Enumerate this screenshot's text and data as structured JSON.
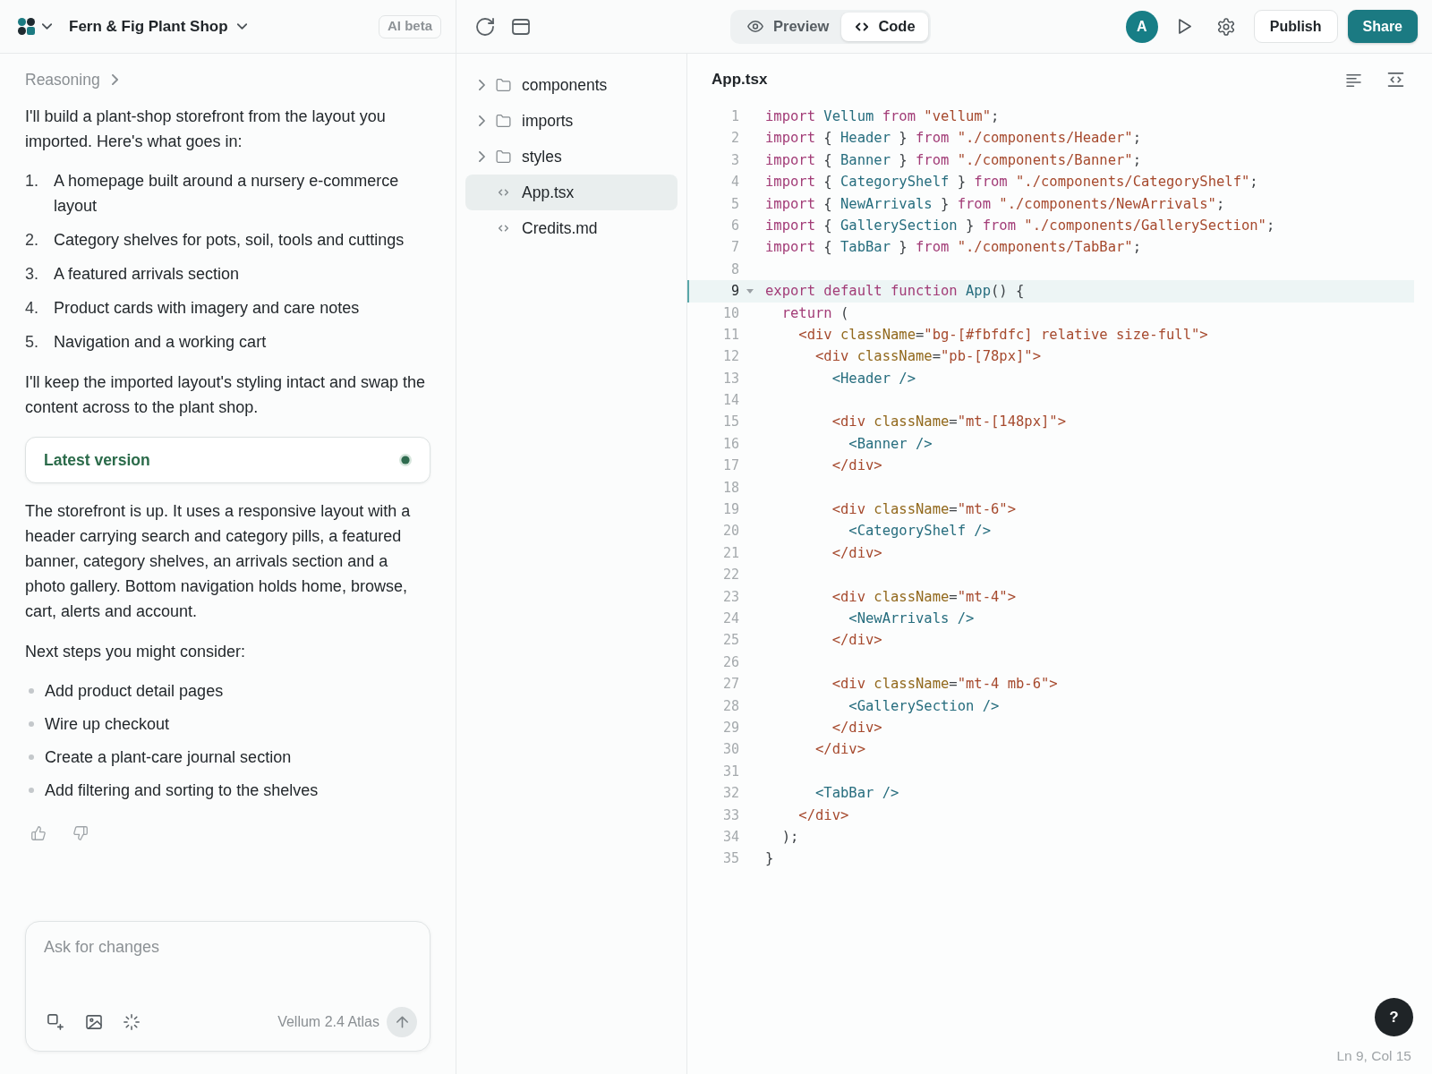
{
  "top_bar": {
    "project_title": "Fern & Fig Plant Shop",
    "badge": "AI beta",
    "view_tabs": [
      {
        "label": "Preview",
        "selected": false
      },
      {
        "label": "Code",
        "selected": true
      }
    ],
    "avatar": "A",
    "buttons": [
      {
        "label": "Publish",
        "kind": "secondary"
      },
      {
        "label": "Share",
        "kind": "primary"
      }
    ]
  },
  "chat": {
    "reasoning_label": "Reasoning",
    "blocks": [
      {
        "kind": "paragraph",
        "text": "I'll build a plant-shop storefront from the layout you imported. Here's what goes in:"
      },
      {
        "kind": "numbered_list",
        "items": [
          {
            "marker": "1.",
            "text": "A homepage built around a nursery e-commerce layout"
          },
          {
            "marker": "2.",
            "text": "Category shelves for pots, soil, tools and cuttings"
          },
          {
            "marker": "3.",
            "text": "A featured arrivals section"
          },
          {
            "marker": "4.",
            "text": "Product cards with imagery and care notes"
          },
          {
            "marker": "5.",
            "text": "Navigation and a working cart"
          }
        ]
      },
      {
        "kind": "paragraph",
        "text": "I'll keep the imported layout's styling intact and swap the content across to the plant shop."
      },
      {
        "kind": "version_card",
        "label": "Latest version"
      },
      {
        "kind": "paragraph",
        "text": "The storefront is up. It uses a responsive layout with a header carrying search and category pills, a featured banner, category shelves, an arrivals section and a photo gallery. Bottom navigation holds home, browse, cart, alerts and account."
      },
      {
        "kind": "paragraph",
        "text": "Next steps you might consider:"
      },
      {
        "kind": "bullet_list",
        "items": [
          "Add product detail pages",
          "Wire up checkout",
          "Create a plant-care journal section",
          "Add filtering and sorting to the shelves"
        ]
      }
    ]
  },
  "composer": {
    "placeholder": "Ask for changes",
    "model": "Vellum 2.4 Atlas"
  },
  "file_tree": {
    "items": [
      {
        "name": "components",
        "kind": "folder",
        "expanded": false,
        "selected": false
      },
      {
        "name": "imports",
        "kind": "folder",
        "expanded": false,
        "selected": false
      },
      {
        "name": "styles",
        "kind": "folder",
        "expanded": false,
        "selected": false
      },
      {
        "name": "App.tsx",
        "kind": "file",
        "selected": true
      },
      {
        "name": "Credits.md",
        "kind": "file",
        "selected": false
      }
    ]
  },
  "editor": {
    "file_name": "App.tsx",
    "lines": [
      {
        "number": "1",
        "selected": false,
        "tokens": [
          {
            "kind": "keyword",
            "text": "import "
          },
          {
            "kind": "identifier",
            "text": "Vellum "
          },
          {
            "kind": "keyword",
            "text": "from "
          },
          {
            "kind": "string",
            "text": "\"vellum\""
          },
          {
            "kind": "punctuation",
            "text": ";"
          }
        ]
      },
      {
        "number": "2",
        "selected": false,
        "tokens": [
          {
            "kind": "keyword",
            "text": "import "
          },
          {
            "kind": "punctuation",
            "text": "{ "
          },
          {
            "kind": "identifier",
            "text": "Header"
          },
          {
            "kind": "punctuation",
            "text": " } "
          },
          {
            "kind": "keyword",
            "text": "from "
          },
          {
            "kind": "string",
            "text": "\"./components/Header\""
          },
          {
            "kind": "punctuation",
            "text": ";"
          }
        ]
      },
      {
        "number": "3",
        "selected": false,
        "tokens": [
          {
            "kind": "keyword",
            "text": "import "
          },
          {
            "kind": "punctuation",
            "text": "{ "
          },
          {
            "kind": "identifier",
            "text": "Banner"
          },
          {
            "kind": "punctuation",
            "text": " } "
          },
          {
            "kind": "keyword",
            "text": "from "
          },
          {
            "kind": "string",
            "text": "\"./components/Banner\""
          },
          {
            "kind": "punctuation",
            "text": ";"
          }
        ]
      },
      {
        "number": "4",
        "selected": false,
        "tokens": [
          {
            "kind": "keyword",
            "text": "import "
          },
          {
            "kind": "punctuation",
            "text": "{ "
          },
          {
            "kind": "identifier",
            "text": "CategoryShelf"
          },
          {
            "kind": "punctuation",
            "text": " } "
          },
          {
            "kind": "keyword",
            "text": "from "
          },
          {
            "kind": "string",
            "text": "\"./components/CategoryShelf\""
          },
          {
            "kind": "punctuation",
            "text": ";"
          }
        ]
      },
      {
        "number": "5",
        "selected": false,
        "tokens": [
          {
            "kind": "keyword",
            "text": "import "
          },
          {
            "kind": "punctuation",
            "text": "{ "
          },
          {
            "kind": "identifier",
            "text": "NewArrivals"
          },
          {
            "kind": "punctuation",
            "text": " } "
          },
          {
            "kind": "keyword",
            "text": "from "
          },
          {
            "kind": "string",
            "text": "\"./components/NewArrivals\""
          },
          {
            "kind": "punctuation",
            "text": ";"
          }
        ]
      },
      {
        "number": "6",
        "selected": false,
        "tokens": [
          {
            "kind": "keyword",
            "text": "import "
          },
          {
            "kind": "punctuation",
            "text": "{ "
          },
          {
            "kind": "identifier",
            "text": "GallerySection"
          },
          {
            "kind": "punctuation",
            "text": " } "
          },
          {
            "kind": "keyword",
            "text": "from "
          },
          {
            "kind": "string",
            "text": "\"./components/GallerySection\""
          },
          {
            "kind": "punctuation",
            "text": ";"
          }
        ]
      },
      {
        "number": "7",
        "selected": false,
        "tokens": [
          {
            "kind": "keyword",
            "text": "import "
          },
          {
            "kind": "punctuation",
            "text": "{ "
          },
          {
            "kind": "identifier",
            "text": "TabBar"
          },
          {
            "kind": "punctuation",
            "text": " } "
          },
          {
            "kind": "keyword",
            "text": "from "
          },
          {
            "kind": "string",
            "text": "\"./components/TabBar\""
          },
          {
            "kind": "punctuation",
            "text": ";"
          }
        ]
      },
      {
        "number": "8",
        "selected": false
      },
      {
        "number": "9",
        "selected": true,
        "tokens": [
          {
            "kind": "keyword",
            "text": "export default function "
          },
          {
            "kind": "identifier",
            "text": "App"
          },
          {
            "kind": "punctuation",
            "text": "() {"
          }
        ]
      },
      {
        "number": "10",
        "selected": false,
        "tokens": [
          {
            "kind": "keyword",
            "text": "  return "
          },
          {
            "kind": "punctuation",
            "text": "("
          }
        ]
      },
      {
        "number": "11",
        "selected": false,
        "tokens": [
          {
            "kind": "tag",
            "text": "    <div "
          },
          {
            "kind": "attribute",
            "text": "className"
          },
          {
            "kind": "punctuation",
            "text": "="
          },
          {
            "kind": "string",
            "text": "\"bg-[#fbfdfc] relative size-full\""
          },
          {
            "kind": "tag",
            "text": ">"
          }
        ]
      },
      {
        "number": "12",
        "selected": false,
        "tokens": [
          {
            "kind": "tag",
            "text": "      <div "
          },
          {
            "kind": "attribute",
            "text": "className"
          },
          {
            "kind": "punctuation",
            "text": "="
          },
          {
            "kind": "string",
            "text": "\"pb-[78px]\""
          },
          {
            "kind": "tag",
            "text": ">"
          }
        ]
      },
      {
        "number": "13",
        "selected": false,
        "tokens": [
          {
            "kind": "component",
            "text": "        <Header />"
          }
        ]
      },
      {
        "number": "14",
        "selected": false
      },
      {
        "number": "15",
        "selected": false,
        "tokens": [
          {
            "kind": "tag",
            "text": "        <div "
          },
          {
            "kind": "attribute",
            "text": "className"
          },
          {
            "kind": "punctuation",
            "text": "="
          },
          {
            "kind": "string",
            "text": "\"mt-[148px]\""
          },
          {
            "kind": "tag",
            "text": ">"
          }
        ]
      },
      {
        "number": "16",
        "selected": false,
        "tokens": [
          {
            "kind": "component",
            "text": "          <Banner />"
          }
        ]
      },
      {
        "number": "17",
        "selected": false,
        "tokens": [
          {
            "kind": "tag",
            "text": "        </div>"
          }
        ]
      },
      {
        "number": "18",
        "selected": false
      },
      {
        "number": "19",
        "selected": false,
        "tokens": [
          {
            "kind": "tag",
            "text": "        <div "
          },
          {
            "kind": "attribute",
            "text": "className"
          },
          {
            "kind": "punctuation",
            "text": "="
          },
          {
            "kind": "string",
            "text": "\"mt-6\""
          },
          {
            "kind": "tag",
            "text": ">"
          }
        ]
      },
      {
        "number": "20",
        "selected": false,
        "tokens": [
          {
            "kind": "component",
            "text": "          <CategoryShelf />"
          }
        ]
      },
      {
        "number": "21",
        "selected": false,
        "tokens": [
          {
            "kind": "tag",
            "text": "        </div>"
          }
        ]
      },
      {
        "number": "22",
        "selected": false
      },
      {
        "number": "23",
        "selected": false,
        "tokens": [
          {
            "kind": "tag",
            "text": "        <div "
          },
          {
            "kind": "attribute",
            "text": "className"
          },
          {
            "kind": "punctuation",
            "text": "="
          },
          {
            "kind": "string",
            "text": "\"mt-4\""
          },
          {
            "kind": "tag",
            "text": ">"
          }
        ]
      },
      {
        "number": "24",
        "selected": false,
        "tokens": [
          {
            "kind": "component",
            "text": "          <NewArrivals />"
          }
        ]
      },
      {
        "number": "25",
        "selected": false,
        "tokens": [
          {
            "kind": "tag",
            "text": "        </div>"
          }
        ]
      },
      {
        "number": "26",
        "selected": false
      },
      {
        "number": "27",
        "selected": false,
        "tokens": [
          {
            "kind": "tag",
            "text": "        <div "
          },
          {
            "kind": "attribute",
            "text": "className"
          },
          {
            "kind": "punctuation",
            "text": "="
          },
          {
            "kind": "string",
            "text": "\"mt-4 mb-6\""
          },
          {
            "kind": "tag",
            "text": ">"
          }
        ]
      },
      {
        "number": "28",
        "selected": false,
        "tokens": [
          {
            "kind": "component",
            "text": "          <GallerySection />"
          }
        ]
      },
      {
        "number": "29",
        "selected": false,
        "tokens": [
          {
            "kind": "tag",
            "text": "        </div>"
          }
        ]
      },
      {
        "number": "30",
        "selected": false,
        "tokens": [
          {
            "kind": "tag",
            "text": "      </div>"
          }
        ]
      },
      {
        "number": "31",
        "selected": false
      },
      {
        "number": "32",
        "selected": false,
        "tokens": [
          {
            "kind": "component",
            "text": "      <TabBar />"
          }
        ]
      },
      {
        "number": "33",
        "selected": false,
        "tokens": [
          {
            "kind": "tag",
            "text": "    </div>"
          }
        ]
      },
      {
        "number": "34",
        "selected": false,
        "tokens": [
          {
            "kind": "punctuation",
            "text": "  );"
          }
        ]
      },
      {
        "number": "35",
        "selected": false,
        "tokens": [
          {
            "kind": "punctuation",
            "text": "}"
          }
        ]
      }
    ],
    "cursor_position": "Ln 9, Col 15"
  },
  "help_button": {
    "label": "?"
  }
}
